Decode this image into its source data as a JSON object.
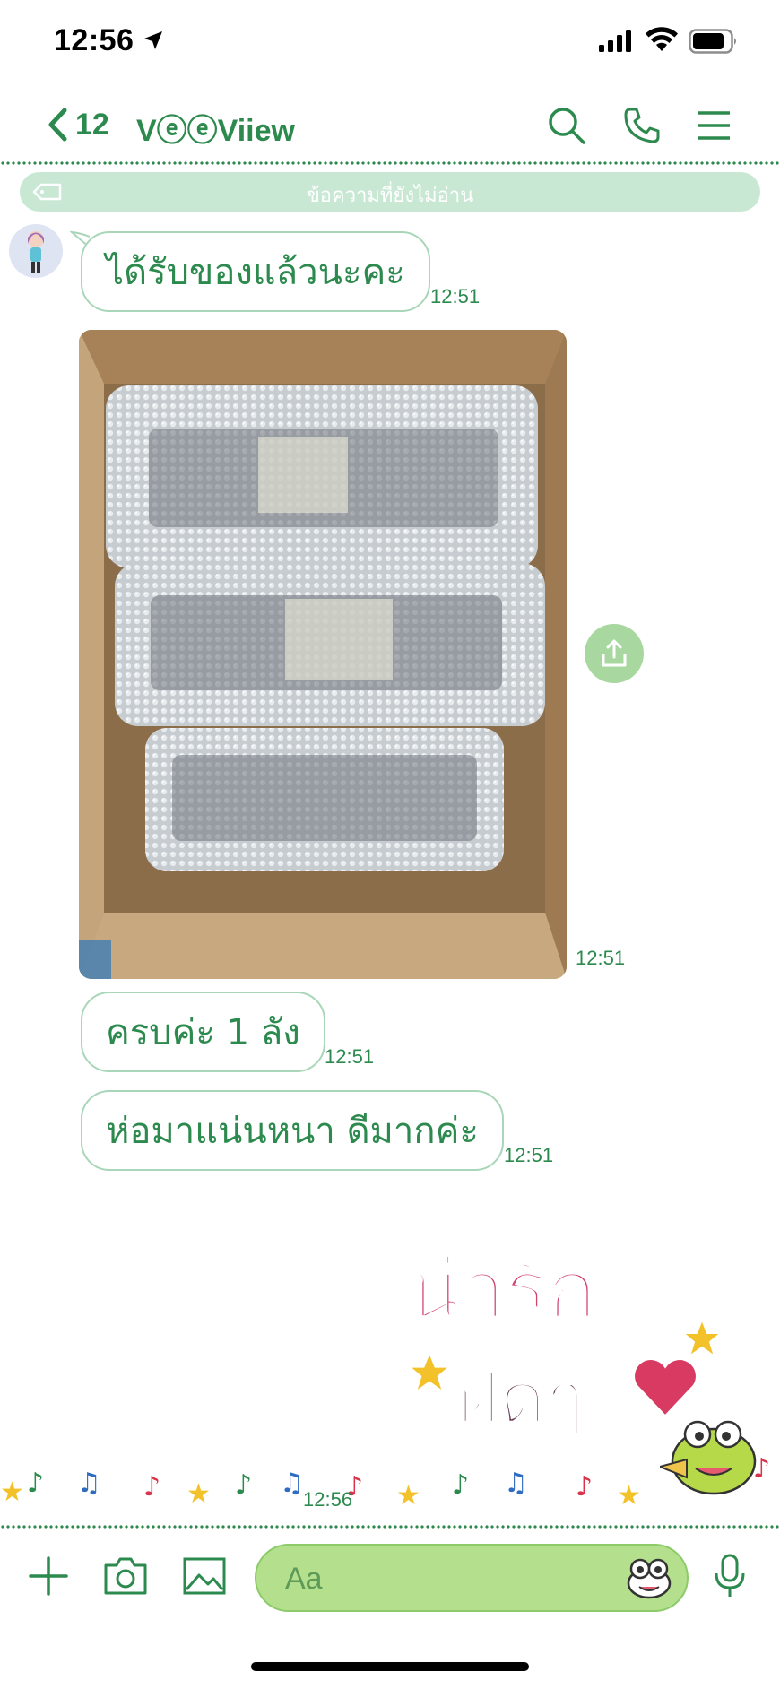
{
  "status_bar": {
    "time": "12:56"
  },
  "header": {
    "back_count": "12",
    "title": "VⓔⓔViiew"
  },
  "unread_banner": {
    "text": "ข้อความที่ยังไม่อ่าน"
  },
  "messages": [
    {
      "text": "ได้รับของแล้วนะคะ",
      "time": "12:51"
    },
    {
      "type": "image",
      "time": "12:51"
    },
    {
      "text": "ครบค่ะ 1 ลัง",
      "time": "12:51"
    },
    {
      "text": "ห่อมาแน่นหนา ดีมากค่ะ",
      "time": "12:51"
    }
  ],
  "sticker": {
    "line1": "น่ารัก",
    "line2": "ฝุดๆ",
    "time": "12:56"
  },
  "input": {
    "placeholder": "Aa"
  },
  "colors": {
    "accent": "#2d8a4e",
    "bubble_border": "#a9d6b8",
    "banner": "#c8e8d4",
    "input_bg": "#b4e08e"
  }
}
